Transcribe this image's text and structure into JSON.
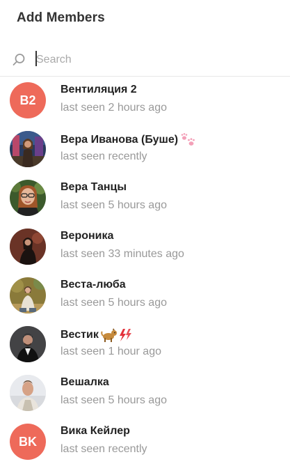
{
  "header": {
    "title": "Add Members"
  },
  "search": {
    "placeholder": "Search",
    "value": ""
  },
  "colors": {
    "initials_avatar": "#ee6a5a",
    "secondary_text": "#999999"
  },
  "members": [
    {
      "name": "Вентиляция 2",
      "status": "last seen 2 hours ago",
      "initials": "B2"
    },
    {
      "name": "Вера Иванова (Буше)",
      "status": "last seen recently",
      "emoji": "paw-prints-icon"
    },
    {
      "name": "Вера Танцы",
      "status": "last seen 5 hours ago"
    },
    {
      "name": "Вероника",
      "status": "last seen 33 minutes ago"
    },
    {
      "name": "Веста-люба",
      "status": "last seen 5 hours ago"
    },
    {
      "name": "Вестик",
      "status": "last seen 1 hour ago",
      "emoji": "dog-and-lightning-icon"
    },
    {
      "name": "Вешалка",
      "status": "last seen 5 hours ago"
    },
    {
      "name": "Вика Кейлер",
      "status": "last seen recently",
      "initials": "BK"
    }
  ]
}
